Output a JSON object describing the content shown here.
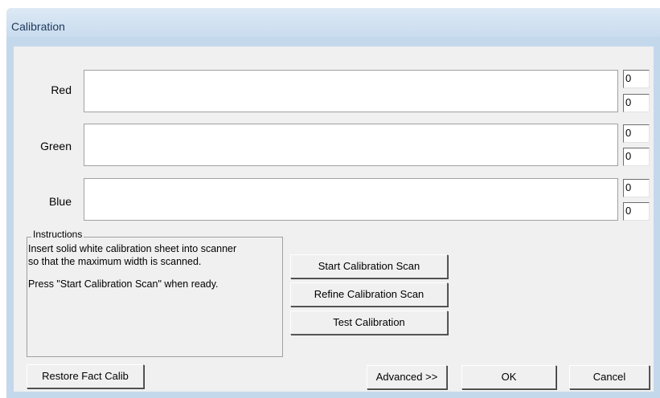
{
  "window": {
    "title": "Calibration"
  },
  "channels": [
    {
      "label": "Red",
      "values": [
        "0",
        "0"
      ]
    },
    {
      "label": "Green",
      "values": [
        "0",
        "0"
      ]
    },
    {
      "label": "Blue",
      "values": [
        "0",
        "0"
      ]
    }
  ],
  "instructions": {
    "legend": "Instructions",
    "line1": "Insert solid white calibration sheet into scanner",
    "line2": "so that the maximum width is scanned.",
    "line3": "Press \"Start Calibration Scan\" when ready."
  },
  "buttons": {
    "start_scan": "Start Calibration Scan",
    "refine_scan": "Refine Calibration Scan",
    "test": "Test Calibration",
    "restore": "Restore Fact Calib",
    "advanced": "Advanced >>",
    "ok": "OK",
    "cancel": "Cancel"
  }
}
